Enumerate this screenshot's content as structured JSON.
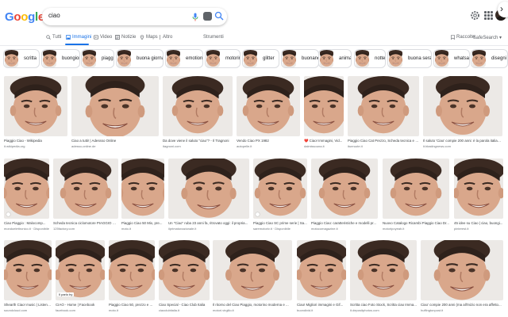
{
  "header": {
    "logo_letters": [
      {
        "ch": "G",
        "color": "#4285F4"
      },
      {
        "ch": "o",
        "color": "#EA4335"
      },
      {
        "ch": "o",
        "color": "#FBBC05"
      },
      {
        "ch": "g",
        "color": "#4285F4"
      },
      {
        "ch": "l",
        "color": "#34A853"
      },
      {
        "ch": "e",
        "color": "#EA4335"
      }
    ],
    "query": "ciao"
  },
  "tabs": {
    "items": [
      {
        "label": "Tutti",
        "icon": "search-icon"
      },
      {
        "label": "Immagini",
        "icon": "image-icon",
        "active": true
      },
      {
        "label": "Video",
        "icon": "video-icon"
      },
      {
        "label": "Notizie",
        "icon": "news-icon"
      },
      {
        "label": "Maps",
        "icon": "map-pin-icon"
      },
      {
        "label": "Altro",
        "icon": "more-icon"
      }
    ],
    "tools": "Strumenti",
    "collections": "Raccolte",
    "safesearch": "SafeSearch ▾"
  },
  "chips": [
    {
      "label": "scritta"
    },
    {
      "label": "buongiorno"
    },
    {
      "label": "piaggio"
    },
    {
      "label": "buona giornata"
    },
    {
      "label": "emotion"
    },
    {
      "label": "motorino"
    },
    {
      "label": "glitter"
    },
    {
      "label": "buonanotte"
    },
    {
      "label": "animato"
    },
    {
      "label": "notte"
    },
    {
      "label": "buona serata"
    },
    {
      "label": "whatsapp"
    },
    {
      "label": "disegni"
    }
  ],
  "results": [
    {
      "title": "Piaggio Ciao - Wikipedia",
      "source": "it.wikipedia.org"
    },
    {
      "title": "Ciao a tutti! | Adessso Online",
      "source": "adesso-online.de"
    },
    {
      "title": "Da dove viene il saluto \"ciao\"? - Il Tragnoni",
      "source": "itagnoni.com"
    },
    {
      "title": "Vendo Ciao PX 1982",
      "source": "autopelle.it"
    },
    {
      "title": "❤️ Ciao! Immagini, Vid...",
      "source": "dalmissouna.it"
    },
    {
      "title": "Piaggio Ciao Cat Prezzo, Scheda tecnica e F...",
      "source": "itueruote.it"
    },
    {
      "title": "Il saluto 'Ciao' compie 200 anni: è la parola italiana ...",
      "source": "it.blastingnews.com"
    },
    {
      "title": "Ciao Piaggio : Malocomp...",
      "source": "mondoelettronico.it · Disponibile"
    },
    {
      "title": "Scheda tecnica ciclomotore PIAGGIO Ci...",
      "source": "125factory.com"
    },
    {
      "title": "Piaggio Ciao 50 Mix, pre...",
      "source": "moto.it"
    },
    {
      "title": "Un \"Ciao\" ruba 23 anni fa, ritrovato oggi: il propria...",
      "source": "ilprimatonazionale.it"
    },
    {
      "title": "Piaggio Ciao SC prime serie | Sa...",
      "source": "saremotoriv.it · Disponibile"
    },
    {
      "title": "Piaggio Ciao: caratteristiche e modelli pr...",
      "source": "motocomagazine.it"
    },
    {
      "title": "Nuovo Catalogo Ricambi Piaggio Ciao Dr...",
      "source": "motoripoyeah.it"
    },
    {
      "title": "45 idee su Ciao | ciao, buongi...",
      "source": "pinterest.it"
    },
    {
      "title": "Shearth Ciao! music | Listen t...",
      "source": "soundcloud.com"
    },
    {
      "title": "CIAO - Home | Facebook",
      "source": "facebook.com"
    },
    {
      "title": "Piaggio Ciao 50, prezzo e ...",
      "source": "moto.it"
    },
    {
      "title": "Ciao Special - Ciao Club Italia",
      "source": "ciaoclubitalia.it"
    },
    {
      "title": "Il ritorno del Ciao Piaggio, motorino moderna e ...",
      "source": "motori.virgilio.it"
    },
    {
      "title": "Ciao! Migliori immagini e Gif...",
      "source": "buondivid.it"
    },
    {
      "title": "Scritta ciao Foto Stock, Scritta ciao Imma...",
      "source": "it.depositphotos.com"
    },
    {
      "title": "Ciao' compie 200 anni (ma all'inizio non era affetto...",
      "source": "huffingtonpost.it"
    }
  ],
  "badges": {
    "tag_label": "Il parlo by"
  },
  "colors": {
    "accent": "#1a73e8",
    "text": "#202124",
    "muted": "#5f6368"
  }
}
